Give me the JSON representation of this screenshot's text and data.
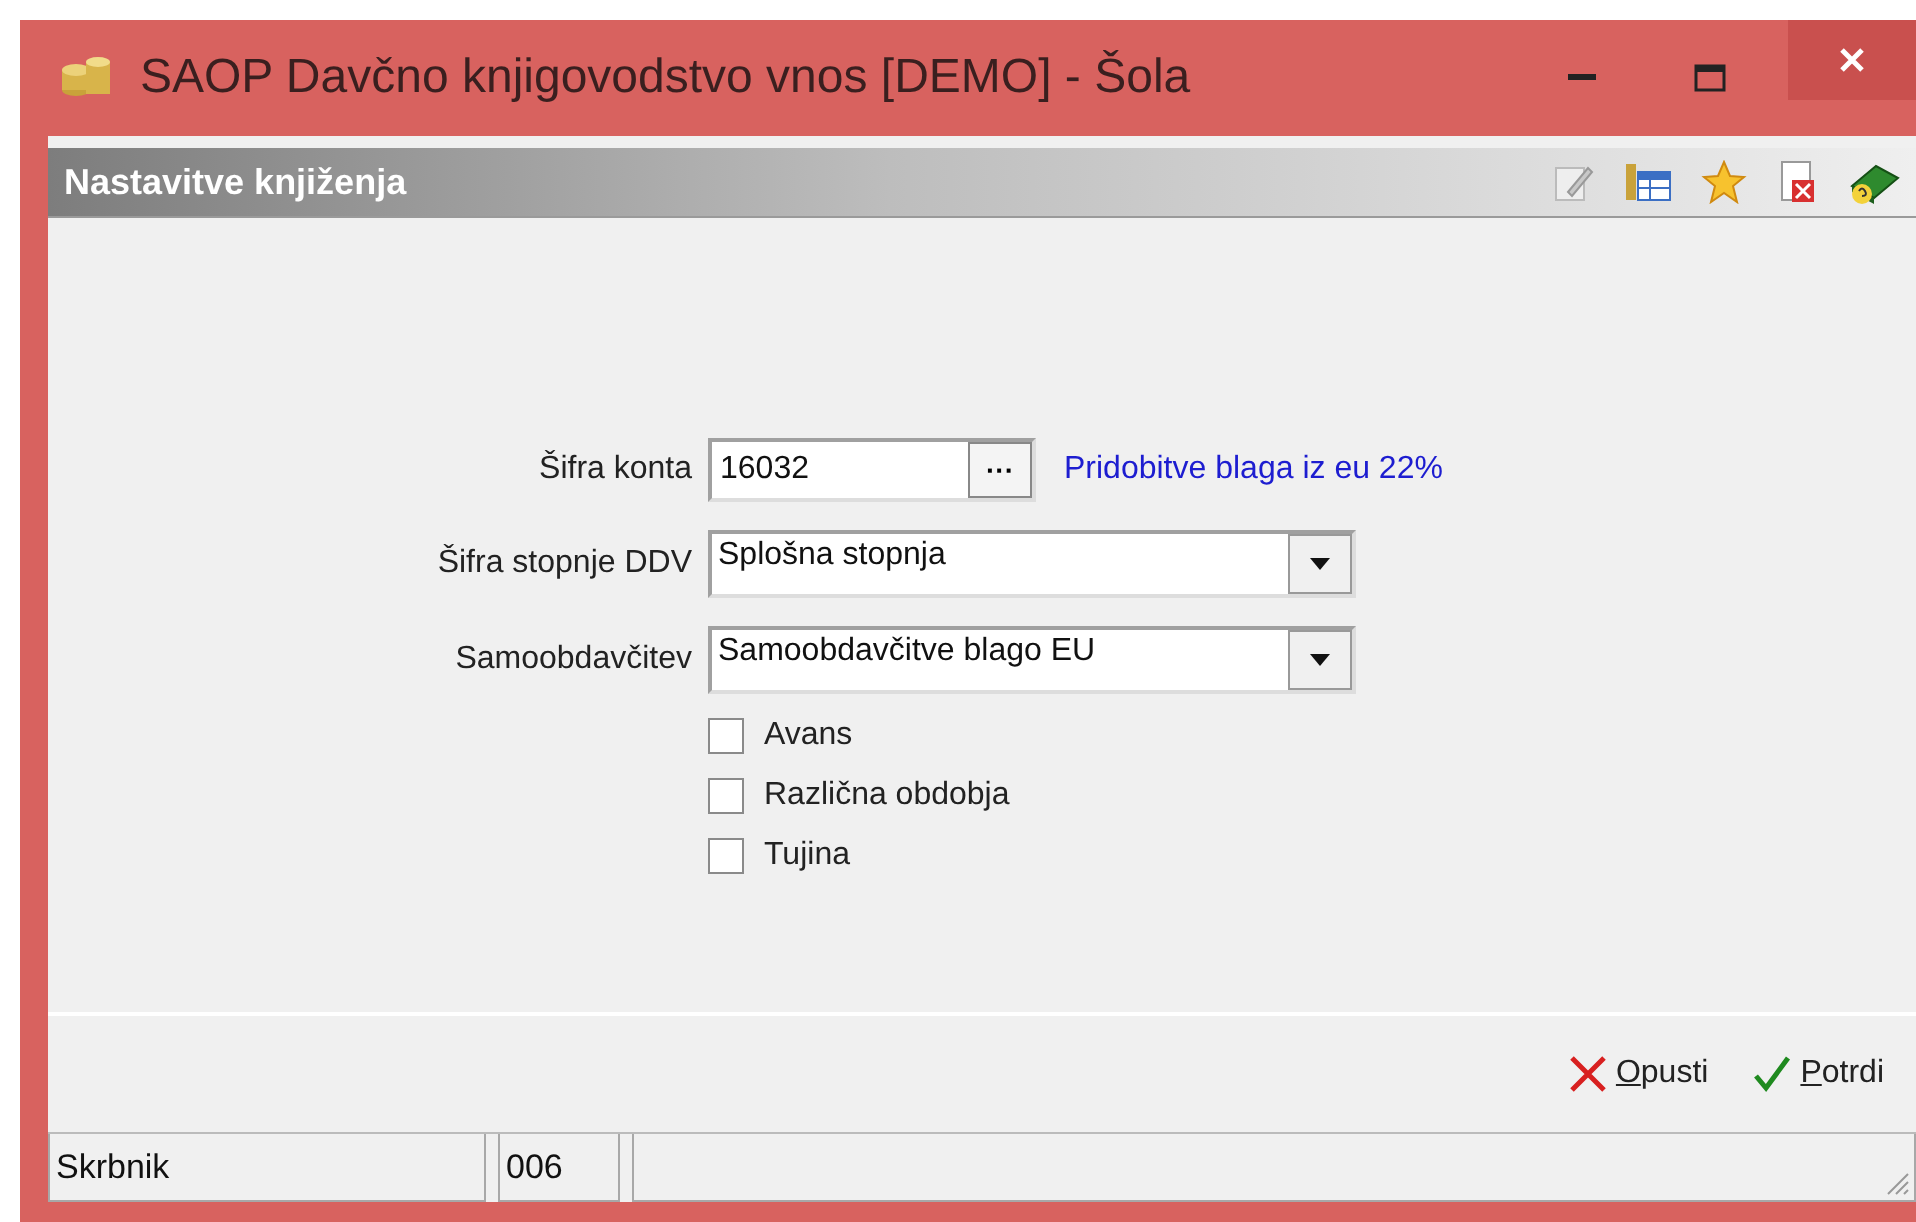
{
  "window": {
    "title": "SAOP  Davčno knjigovodstvo vnos [DEMO] - Šola"
  },
  "header": {
    "title": "Nastavitve knjiženja"
  },
  "form": {
    "account": {
      "label": "Šifra konta",
      "value": "16032",
      "browse": "···",
      "description": "Pridobitve blaga iz eu 22%"
    },
    "combos": [
      {
        "label": "Šifra stopnje DDV",
        "value": "Splošna stopnja"
      },
      {
        "label": "Samoobdavčitev",
        "value": "Samoobdavčitve blago EU"
      }
    ],
    "checkboxes": [
      {
        "label": "Avans",
        "checked": false
      },
      {
        "label": "Različna obdobja",
        "checked": false
      },
      {
        "label": "Tujina",
        "checked": false
      }
    ]
  },
  "buttons": [
    {
      "kind": "cancel",
      "label": "Opusti"
    },
    {
      "kind": "confirm",
      "label": "Potrdi"
    }
  ],
  "status_bar": [
    "Skrbnik",
    "006"
  ]
}
